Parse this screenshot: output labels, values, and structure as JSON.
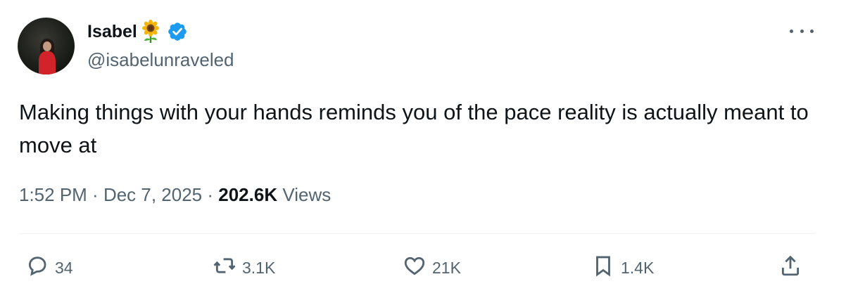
{
  "author": {
    "display_name": "Isabel",
    "name_emoji": "sunflower-emoji",
    "verified_icon": "verified-badge-icon",
    "handle": "@isabelunraveled",
    "accent_color": "#1d9bf0"
  },
  "tweet": {
    "text": "Making things with your hands reminds you of the pace reality is actually meant to move at",
    "time": "1:52 PM",
    "separator": " · ",
    "date": "Dec 7, 2025",
    "views_count": "202.6K",
    "views_label": " Views"
  },
  "actions": {
    "replies": "34",
    "reposts": "3.1K",
    "likes": "21K",
    "bookmarks": "1.4K"
  },
  "icons": {
    "reply": "reply-icon",
    "repost": "repost-icon",
    "like": "heart-icon",
    "bookmark": "bookmark-icon",
    "share": "share-icon",
    "more": "more-icon"
  }
}
